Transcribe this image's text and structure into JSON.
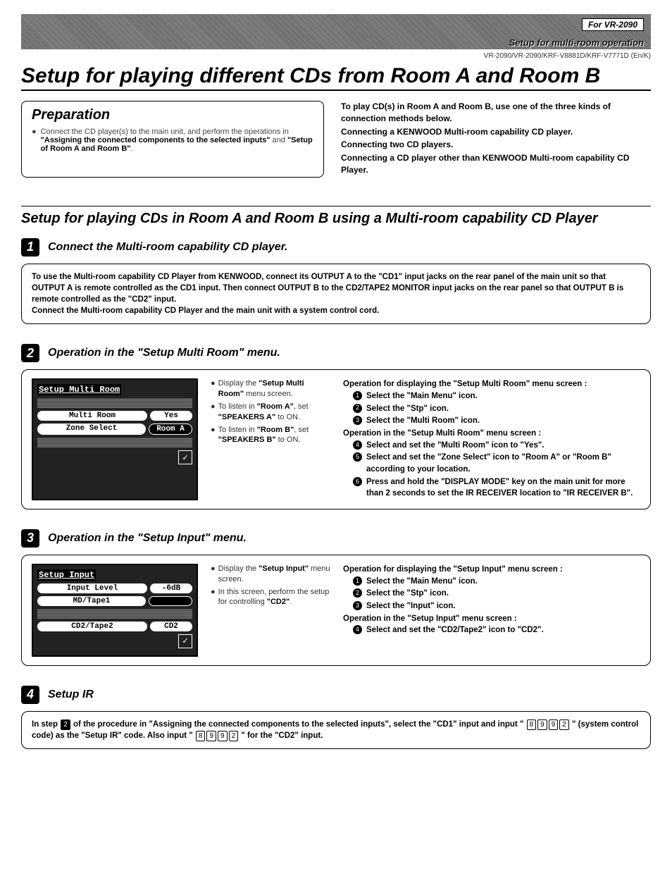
{
  "header": {
    "badge": "For VR-2090",
    "subtitle": "Setup for multi-room operation",
    "model_line": "VR-2090/VR-2090/KRF-V8881D/KRF-V7771D (En/K)"
  },
  "main_title": "Setup for playing different CDs from Room A and Room B",
  "preparation": {
    "heading": "Preparation",
    "bullet_pre": "Connect the CD player(s) to the main unit, and perform the operations in ",
    "bullet_b1": "\"Assigning the connected components to the selected inputs\"",
    "bullet_mid": " and ",
    "bullet_b2": "\"Setup of Room A and Room B\"",
    "bullet_post": "."
  },
  "intro": {
    "l1": "To play CD(s) in Room A and Room B, use one of the three kinds of connection methods below.",
    "l2": "Connecting a KENWOOD Multi-room capability CD player.",
    "l3": "Connecting two CD players.",
    "l4": "Connecting a CD player other than KENWOOD Multi-room capability CD Player."
  },
  "sub_title": "Setup for playing CDs in Room A and Room B using a Multi-room capability CD Player",
  "step1": {
    "num": "1",
    "title": "Connect the Multi-room capability CD player.",
    "box": "To use the Multi-room capability CD Player from KENWOOD, connect its OUTPUT A to the \"CD1\" input jacks on the rear panel of the main unit so that OUTPUT A is remote controlled as the CD1 input. Then connect OUTPUT B to the CD2/TAPE2 MONITOR input jacks on the rear panel so that OUTPUT B is remote controlled as the \"CD2\" input.",
    "box2": "Connect the Multi-room capability CD Player and the main unit with a   system control cord."
  },
  "step2": {
    "num": "2",
    "title": "Operation in the \"Setup Multi Room\" menu.",
    "screen_title": "Setup Multi Room",
    "row1a": "Multi Room",
    "row1b": "Yes",
    "row2a": "Zone Select",
    "row2b": "Room A",
    "mid": {
      "m1a": "Display the ",
      "m1b": "\"Setup Multi Room\"",
      "m1c": " menu screen.",
      "m2a": "To listen in ",
      "m2b": "\"Room A\"",
      "m2c": ", set ",
      "m2d": "\"SPEAKERS A\"",
      "m2e": " to ON.",
      "m3a": "To listen in ",
      "m3b": "\"Room B\"",
      "m3c": ", set ",
      "m3d": "\"SPEAKERS B\"",
      "m3e": " to ON."
    },
    "right": {
      "h1": "Operation for displaying the \"Setup Multi Room\" menu screen :",
      "r1": "Select the \"Main Menu\" icon.",
      "r2": "Select the \"Stp\" icon.",
      "r3": "Select the \"Multi Room\" icon.",
      "h2": "Operation in the \"Setup Multi Room\" menu screen :",
      "r4": "Select and set the \"Multi Room\" icon to \"Yes\".",
      "r5": "Select and set the \"Zone Select\" icon to \"Room A\" or \"Room B\" according to your location.",
      "r6": "Press and hold the \"DISPLAY MODE\" key on the main unit for more than 2 seconds to set the IR RECEIVER location to \"IR RECEIVER B\"."
    }
  },
  "step3": {
    "num": "3",
    "title": "Operation in the \"Setup Input\" menu.",
    "screen_title": "Setup Input",
    "row1a": "Input Level",
    "row1b": "-6dB",
    "row2a": "MD/Tape1",
    "row2b": " ",
    "row3a": "CD2/Tape2",
    "row3b": "CD2",
    "mid": {
      "m1a": "Display the ",
      "m1b": "\"Setup Input\"",
      "m1c": " menu screen.",
      "m2a": "In this screen, perform the setup for controlling ",
      "m2b": "\"CD2\"",
      "m2c": "."
    },
    "right": {
      "h1": "Operation for displaying the \"Setup Input\" menu screen :",
      "r1": "Select the \"Main Menu\" icon.",
      "r2": "Select the \"Stp\" icon.",
      "r3": "Select the \"Input\" icon.",
      "h2": "Operation in the \"Setup Input\" menu screen :",
      "r4": "Select and set the \"CD2/Tape2\" icon to \"CD2\"."
    }
  },
  "step4": {
    "num": "4",
    "title": "Setup IR",
    "box_pre": "In step ",
    "box_stepref": "2",
    "box_mid1": " of the procedure in \"Assigning the connected components to the selected inputs\", select the \"CD1\" input and input \" ",
    "keys1": [
      "8",
      "9",
      "9",
      "2"
    ],
    "box_mid2": " \" (system control code) as the \"Setup IR\" code. Also input  \" ",
    "keys2": [
      "8",
      "9",
      "9",
      "2"
    ],
    "box_post": " \"  for the \"CD2\" input."
  }
}
